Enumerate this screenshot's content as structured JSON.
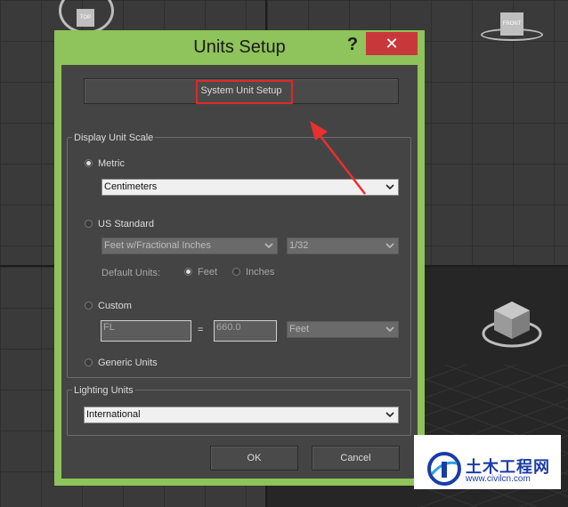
{
  "viewports": {
    "top_label": "TOP",
    "front_label": "FRONT"
  },
  "dialog": {
    "title": "Units Setup",
    "help": "?",
    "close": "✕",
    "system_unit_setup": "System Unit Setup",
    "display_unit_scale": {
      "label": "Display Unit Scale",
      "metric": {
        "label": "Metric",
        "selected": true,
        "value": "Centimeters"
      },
      "us_standard": {
        "label": "US Standard",
        "selected": false,
        "value": "Feet w/Fractional Inches",
        "fraction": "1/32",
        "default_units_label": "Default Units:",
        "feet": "Feet",
        "inches": "Inches",
        "default_feet_selected": true
      },
      "custom": {
        "label": "Custom",
        "selected": false,
        "name": "FL",
        "equals": "=",
        "value": "660.0",
        "unit": "Feet"
      },
      "generic": {
        "label": "Generic Units",
        "selected": false
      }
    },
    "lighting_units": {
      "label": "Lighting Units",
      "value": "International"
    },
    "ok": "OK",
    "cancel": "Cancel"
  },
  "watermark": {
    "brand": "土木工程网",
    "url": "www.civilcn.com"
  },
  "colors": {
    "dialog_frame": "#8fc35b",
    "client_bg": "#444444",
    "close_button": "#c8373a",
    "highlight": "#e02828"
  }
}
